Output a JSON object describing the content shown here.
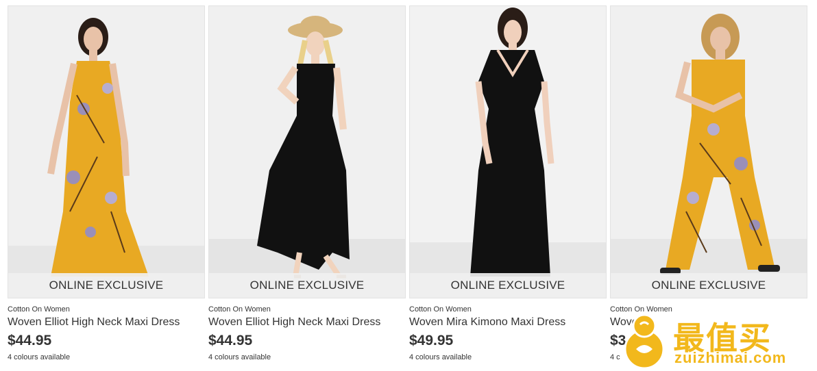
{
  "products": [
    {
      "badge": "ONLINE EXCLUSIVE",
      "brand": "Cotton On Women",
      "name": "Woven Elliot High Neck Maxi Dress",
      "price": "$44.95",
      "colours": "4 colours available",
      "garment_color": "#e8a923"
    },
    {
      "badge": "ONLINE EXCLUSIVE",
      "brand": "Cotton On Women",
      "name": "Woven Elliot High Neck Maxi Dress",
      "price": "$44.95",
      "colours": "4 colours available",
      "garment_color": "#111111"
    },
    {
      "badge": "ONLINE EXCLUSIVE",
      "brand": "Cotton On Women",
      "name": "Woven Mira Kimono Maxi Dress",
      "price": "$49.95",
      "colours": "4 colours available",
      "garment_color": "#111111"
    },
    {
      "badge": "ONLINE EXCLUSIVE",
      "brand": "Cotton On Women",
      "name": "Woven B",
      "price": "$3",
      "colours": "4 c",
      "garment_color": "#e8a923"
    }
  ],
  "watermark": {
    "text": "最值买",
    "domain": "zuizhimai.com",
    "color": "#f2b81c"
  }
}
